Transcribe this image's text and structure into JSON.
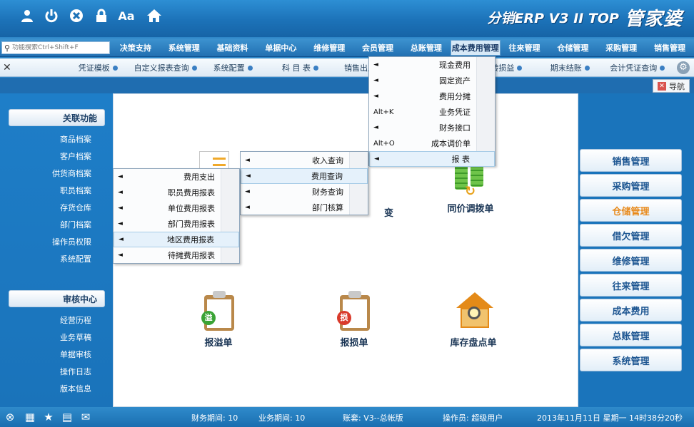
{
  "app": {
    "brand_main": "管家婆",
    "brand_sub": "分销ERP V3 II TOP",
    "title_icons": [
      "user-icon",
      "power-icon",
      "close-icon",
      "lock-icon",
      "font-icon",
      "home-icon"
    ]
  },
  "search": {
    "placeholder": "功能搜索Ctrl+Shift+F"
  },
  "menubar": {
    "items": [
      "决策支持",
      "系统管理",
      "基础资料",
      "单据中心",
      "维修管理",
      "会员管理",
      "总账管理",
      "成本费用管理",
      "往来管理",
      "仓储管理",
      "采购管理",
      "销售管理"
    ],
    "active_index": 7
  },
  "quickbar": {
    "items": [
      "凭证模板",
      "自定义报表查询",
      "系统配置",
      "科 目 表",
      "销售出库单",
      "期末结账",
      "结转损益",
      "期末结账",
      "会计凭证查询"
    ]
  },
  "nav_tab": {
    "label": "导航"
  },
  "left_panel": {
    "section1_title": "关联功能",
    "section1_items": [
      "商品档案",
      "客户档案",
      "供货商档案",
      "职员档案",
      "存货仓库",
      "部门档案",
      "操作员权限",
      "系统配置"
    ],
    "section2_title": "审核中心",
    "section2_items": [
      "经营历程",
      "业务草稿",
      "单据审核",
      "操作日志",
      "版本信息"
    ]
  },
  "right_panel": {
    "items": [
      "销售管理",
      "采购管理",
      "仓储管理",
      "借欠管理",
      "维修管理",
      "往来管理",
      "成本费用",
      "总账管理",
      "系统管理"
    ],
    "active_index": 2
  },
  "tiles": {
    "price_transfer": "同价调拨单",
    "change": "变",
    "overflow": "报溢单",
    "loss": "报损单",
    "inventory": "库存盘点单",
    "overflow_badge": "溢",
    "loss_badge": "损"
  },
  "menu_main": {
    "items": [
      {
        "label": "现金费用",
        "shortcut": ""
      },
      {
        "label": "固定资产",
        "shortcut": ""
      },
      {
        "label": "费用分摊",
        "shortcut": ""
      },
      {
        "label": "业务凭证",
        "shortcut": "Alt+K"
      },
      {
        "label": "财务接口",
        "shortcut": ""
      },
      {
        "label": "成本调价单",
        "shortcut": "Alt+O"
      },
      {
        "label": "报 表",
        "shortcut": ""
      }
    ]
  },
  "menu_report": {
    "items": [
      "收入查询",
      "费用查询",
      "财务查询",
      "部门核算"
    ]
  },
  "menu_expense": {
    "items": [
      "费用支出",
      "职员费用报表",
      "单位费用报表",
      "部门费用报表",
      "地区费用报表",
      "待摊费用报表"
    ]
  },
  "statusbar": {
    "datetime": "2013年11月11日 星期一 14时38分20秒",
    "operator": "操作员: 超级用户",
    "ledger": "账套: V3--总帐版",
    "business_period": "业务期间: 10",
    "finance_period": "财务期间: 10"
  }
}
